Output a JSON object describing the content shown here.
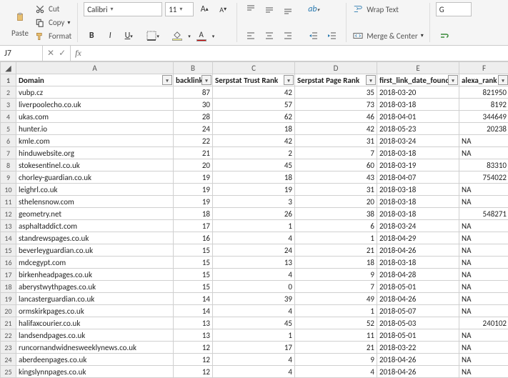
{
  "ribbon": {
    "paste": "Paste",
    "cut": "Cut",
    "copy": "Copy",
    "format": "Format",
    "font_name": "Calibri",
    "font_size": "11",
    "wrap": "Wrap Text",
    "merge": "Merge & Center"
  },
  "namebox": {
    "cell": "J7",
    "fx": "fx"
  },
  "headers": {
    "A": "Domain",
    "B": "backlinks",
    "C": "Serpstat Trust Rank",
    "D": "Serpstat Page Rank",
    "E": "first_link_date_found",
    "F": "alexa_rank"
  },
  "cols": [
    "A",
    "B",
    "C",
    "D",
    "E",
    "F"
  ],
  "rows": [
    {
      "n": 2,
      "A": "vubp.cz",
      "B": 87,
      "C": 42,
      "D": 35,
      "E": "2018-03-20",
      "F": "821950"
    },
    {
      "n": 3,
      "A": "liverpoolecho.co.uk",
      "B": 30,
      "C": 57,
      "D": 73,
      "E": "2018-03-18",
      "F": "8192"
    },
    {
      "n": 4,
      "A": "ukas.com",
      "B": 28,
      "C": 62,
      "D": 46,
      "E": "2018-04-01",
      "F": "344649"
    },
    {
      "n": 5,
      "A": "hunter.io",
      "B": 24,
      "C": 18,
      "D": 42,
      "E": "2018-05-23",
      "F": "20238"
    },
    {
      "n": 6,
      "A": "kmle.com",
      "B": 22,
      "C": 42,
      "D": 31,
      "E": "2018-03-24",
      "F": "NA"
    },
    {
      "n": 7,
      "A": "hinduwebsite.org",
      "B": 21,
      "C": 2,
      "D": 7,
      "E": "2018-03-18",
      "F": "NA"
    },
    {
      "n": 8,
      "A": "stokesentinel.co.uk",
      "B": 20,
      "C": 45,
      "D": 60,
      "E": "2018-03-19",
      "F": "83310"
    },
    {
      "n": 9,
      "A": "chorley-guardian.co.uk",
      "B": 19,
      "C": 18,
      "D": 43,
      "E": "2018-04-07",
      "F": "754022"
    },
    {
      "n": 10,
      "A": "leighrl.co.uk",
      "B": 19,
      "C": 19,
      "D": 31,
      "E": "2018-03-18",
      "F": "NA"
    },
    {
      "n": 11,
      "A": "sthelensnow.com",
      "B": 19,
      "C": 3,
      "D": 20,
      "E": "2018-03-18",
      "F": "NA"
    },
    {
      "n": 12,
      "A": "geometry.net",
      "B": 18,
      "C": 26,
      "D": 38,
      "E": "2018-03-18",
      "F": "548271"
    },
    {
      "n": 13,
      "A": "asphaltaddict.com",
      "B": 17,
      "C": 1,
      "D": 6,
      "E": "2018-03-24",
      "F": "NA"
    },
    {
      "n": 14,
      "A": "standrewspages.co.uk",
      "B": 16,
      "C": 4,
      "D": 1,
      "E": "2018-04-29",
      "F": "NA"
    },
    {
      "n": 15,
      "A": "beverleyguardian.co.uk",
      "B": 15,
      "C": 24,
      "D": 21,
      "E": "2018-04-26",
      "F": "NA"
    },
    {
      "n": 16,
      "A": "mdcegypt.com",
      "B": 15,
      "C": 13,
      "D": 18,
      "E": "2018-03-18",
      "F": "NA"
    },
    {
      "n": 17,
      "A": "birkenheadpages.co.uk",
      "B": 15,
      "C": 4,
      "D": 9,
      "E": "2018-04-28",
      "F": "NA"
    },
    {
      "n": 18,
      "A": "aberystwythpages.co.uk",
      "B": 15,
      "C": 0,
      "D": 7,
      "E": "2018-05-01",
      "F": "NA"
    },
    {
      "n": 19,
      "A": "lancasterguardian.co.uk",
      "B": 14,
      "C": 39,
      "D": 49,
      "E": "2018-04-26",
      "F": "NA"
    },
    {
      "n": 20,
      "A": "ormskirkpages.co.uk",
      "B": 14,
      "C": 4,
      "D": 1,
      "E": "2018-05-07",
      "F": "NA"
    },
    {
      "n": 21,
      "A": "halifaxcourier.co.uk",
      "B": 13,
      "C": 45,
      "D": 52,
      "E": "2018-05-03",
      "F": "240102"
    },
    {
      "n": 22,
      "A": "landsendpages.co.uk",
      "B": 13,
      "C": 1,
      "D": 11,
      "E": "2018-05-01",
      "F": "NA"
    },
    {
      "n": 23,
      "A": "runcornandwidnesweeklynews.co.uk",
      "B": 12,
      "C": 17,
      "D": 21,
      "E": "2018-03-22",
      "F": "NA"
    },
    {
      "n": 24,
      "A": "aberdeenpages.co.uk",
      "B": 12,
      "C": 4,
      "D": 9,
      "E": "2018-04-26",
      "F": "NA"
    },
    {
      "n": 25,
      "A": "kingslynnpages.co.uk",
      "B": 12,
      "C": 4,
      "D": 4,
      "E": "2018-04-26",
      "F": "NA"
    }
  ]
}
